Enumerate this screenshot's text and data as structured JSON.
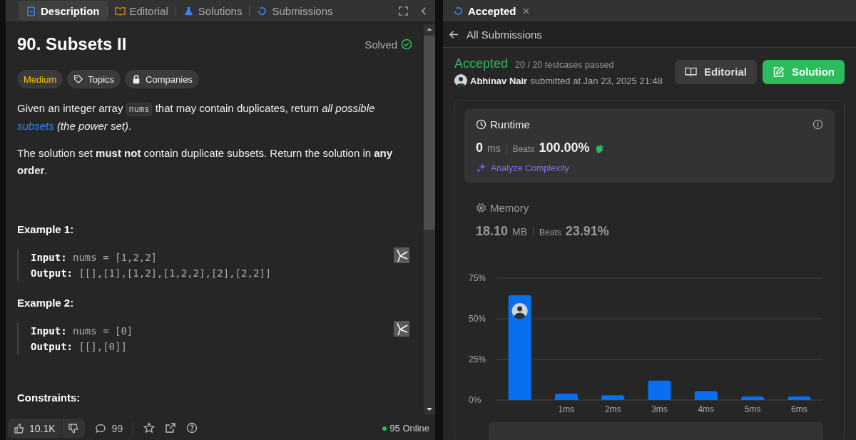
{
  "problem_tabs": [
    {
      "label": "Description",
      "selected": true
    },
    {
      "label": "Editorial",
      "selected": false
    },
    {
      "label": "Solutions",
      "selected": false
    },
    {
      "label": "Submissions",
      "selected": false
    }
  ],
  "problem": {
    "title": "90. Subsets II",
    "status": "Solved",
    "tags": [
      {
        "label": "Medium",
        "kind": "difficulty"
      },
      {
        "label": "Topics",
        "kind": "topics"
      },
      {
        "label": "Companies",
        "kind": "companies"
      }
    ],
    "paragraphs": [
      [
        {
          "kind": "text",
          "text": "Given an integer array "
        },
        {
          "kind": "code",
          "text": "nums"
        },
        {
          "kind": "text",
          "text": " that may contain duplicates, return *all possible* "
        },
        {
          "kind": "link",
          "text": "subsets"
        },
        {
          "kind": "text",
          "text": " *(the power set)*."
        }
      ],
      [
        {
          "kind": "text",
          "text": "The solution set **must not** contain duplicate subsets. Return the solution in **any order**."
        }
      ]
    ],
    "examples": [
      {
        "title": "Example 1:",
        "input_label": "Input:",
        "input": "nums = [1,2,2]",
        "output_label": "Output:",
        "output": "[[],[1],[1,2],[1,2,2],[2],[2,2]]"
      },
      {
        "title": "Example 2:",
        "input_label": "Input:",
        "input": "nums = [0]",
        "output_label": "Output:",
        "output": "[[],[0]]"
      }
    ],
    "constraints_title": "Constraints:"
  },
  "footer": {
    "likes": "10.1K",
    "comments": "99",
    "online": "95 Online"
  },
  "result_tab": {
    "label": "Accepted"
  },
  "back_link": "All Submissions",
  "submission": {
    "status": "Accepted",
    "testcases": "20 / 20 testcases passed",
    "user": "Abhinav Nair",
    "submitted": "submitted at Jan 23, 2025 21:48",
    "buttons": [
      {
        "label": "Editorial",
        "kind": "editorial"
      },
      {
        "label": "Solution",
        "kind": "solution"
      }
    ]
  },
  "metrics": [
    {
      "kind": "runtime",
      "label": "Runtime",
      "value": "0",
      "unit": "ms",
      "beats_label": "Beats",
      "beats": "100.00%",
      "selected": true,
      "link": "Analyze Complexity"
    },
    {
      "kind": "memory",
      "label": "Memory",
      "value": "18.10",
      "unit": "MB",
      "beats_label": "Beats",
      "beats": "23.91%",
      "selected": false
    }
  ],
  "chart_data": {
    "type": "bar",
    "x": [
      0,
      1,
      2,
      3,
      4,
      5,
      6
    ],
    "xlim": [
      -0.5,
      6.5
    ],
    "series": [
      {
        "color": "#0a6fef",
        "values": [
          64.5,
          4,
          3,
          12,
          5.5,
          2.2,
          2.2
        ]
      }
    ],
    "ylim": [
      0,
      75
    ],
    "yticks": [
      {
        "value": 0,
        "label": "0%"
      },
      {
        "value": 25,
        "label": "25%"
      },
      {
        "value": 50,
        "label": "50%"
      },
      {
        "value": 75,
        "label": "75%"
      }
    ],
    "xticks": [
      {
        "value": 1,
        "label": "1ms"
      },
      {
        "value": 2,
        "label": "2ms"
      },
      {
        "value": 3,
        "label": "3ms"
      },
      {
        "value": 4,
        "label": "4ms"
      },
      {
        "value": 5,
        "label": "5ms"
      },
      {
        "value": 6,
        "label": "6ms"
      }
    ]
  }
}
